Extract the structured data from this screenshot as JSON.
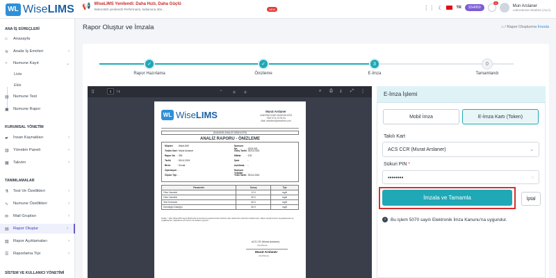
{
  "brand": {
    "badge": "WL",
    "name_light": "Wise",
    "name_bold": "LIMS"
  },
  "announcement": {
    "title": "WiseLIMS Yenilendi: Daha Hızlı, Daha Güçlü",
    "subtitle": "WiseLIMS yenilendi! Performans, kullanıma dön…",
    "badge": "NEW"
  },
  "topbar": {
    "lang": "TR",
    "storage_badge": "SS4950",
    "notif_count": "0",
    "user_name": "Mun Arslaner",
    "user_role": "Laboratuvar Müdürü (ALA)"
  },
  "sidebar": {
    "section1": "ANA İŞ SÜREÇLERİ",
    "section2": "KURUMSAL YÖNETİM",
    "section3": "TANIMLAMALAR",
    "section4": "SİSTEM VE KULLANICI YÖNETİMİ",
    "items": [
      {
        "label": "Anasayfa"
      },
      {
        "label": "Analiz İş Emirleri"
      },
      {
        "label": "Numune Kayıt"
      },
      {
        "label": "Numune Test"
      },
      {
        "label": "Numune Rapor"
      },
      {
        "label": "İnsan Kaynakları"
      },
      {
        "label": "Yönetim Paneli"
      },
      {
        "label": "Takvim"
      },
      {
        "label": "Test Ve Özellikleri"
      },
      {
        "label": "Numune Özellikleri"
      },
      {
        "label": "Mail Grupları"
      },
      {
        "label": "Rapor Oluştur"
      },
      {
        "label": "Rapor Açıklamaları"
      },
      {
        "label": "Raporlama Tipi"
      }
    ],
    "sub": {
      "liste": "Liste",
      "ekle": "Ekle"
    }
  },
  "page": {
    "title": "Rapor Oluştur ve İmzala",
    "breadcrumb_parent": "Rapor Oluşturma",
    "breadcrumb_current": "İmzala"
  },
  "steps": [
    {
      "label": "Rapor Hazırlama",
      "mark": "✓"
    },
    {
      "label": "Önizleme",
      "mark": "✓"
    },
    {
      "label": "E-İmza",
      "mark": "3"
    },
    {
      "label": "Tamamlandı",
      "mark": "0"
    }
  ],
  "viewer": {
    "page": "1",
    "page_total": "/ 1"
  },
  "doc": {
    "company": "Murat Arslaner",
    "company_sub": "LABORATUVAR MÜDÜRLÜĞÜ",
    "company_tel": "+567 673 10 05 00",
    "company_mail": "Mail: wiselims@wiselims.com",
    "head_bar": "[NUMUNE ANALİZİ ARŞİVLERİ]",
    "title": "ANALİZ RAPORU - ÖNİZLEME",
    "left": [
      {
        "k": "Müşteri",
        "v": ": WiseLIMS"
      },
      {
        "k": "Teslim Kart",
        "v": ": Murat Arslaner"
      },
      {
        "k": "Rapor No",
        "v": ": 335"
      },
      {
        "k": "Tarihi",
        "v": ": 05.04.2024"
      },
      {
        "k": "Birim",
        "v": ": Sonda"
      },
      {
        "k": "Operasyon",
        "v": ": -"
      },
      {
        "k": "Ölçüm Tipi",
        "v": ": -"
      }
    ],
    "right": [
      {
        "k": "Numune No",
        "v": ": 2024-001"
      },
      {
        "k": "Geliş Tarihi",
        "v": ": 05.04.2024"
      },
      {
        "k": "Miktar",
        "v": ": 100"
      },
      {
        "k": "Şartı",
        "v": ": -"
      },
      {
        "k": "Açıklama",
        "v": ": -"
      },
      {
        "k": "Numune Yetkilisi",
        "v": ": -"
      },
      {
        "k": "Yetki Tarihi",
        "v": ": 05.04.2024"
      }
    ],
    "table_headers": [
      "Parametre",
      "Sonuç",
      "Tipi"
    ],
    "table_rows": [
      [
        "Ofon Hazdeki",
        "12.0",
        "mg/lt"
      ],
      [
        "Ofon Hazdeki",
        "50.0",
        "mg/lt"
      ],
      [
        "Test Kodunde",
        "60.0",
        "mg/lt"
      ],
      [
        "Demiloğlu Katılığın",
        "60.0",
        "mg/lt"
      ]
    ],
    "note": "Notlar: * İşbu WiseLIMS sayılı Elektronik İmza kanunu kapsamında üretilmiş olup elektronik ortamda imzalanmıştır. Rapor içeriği kısmen kopyalanamaz ve çoğaltılamaz; doğrulama için kurum ile iletişime geçiniz.",
    "sig1": "ACS CR (Murat Arslaner)",
    "sig1_sub": "(Sertifikası)",
    "sig2": "Murat Arslaner",
    "sig2_sub": "(Sertifikası)"
  },
  "esign": {
    "title": "E-İmza İşlemi",
    "tab_mobile": "Mobil İmza",
    "tab_token": "E-İmza Kartı (Token)",
    "card_label": "Takılı Kart",
    "card_value": "ACS CCR (Murat Arslaner)",
    "pin_label": "Sükuri PIN",
    "pin_required": "*",
    "pin_value": "••••••••",
    "sign_button": "İmzala ve Tamamla",
    "cancel_button": "İptal",
    "info_text": "Bu işlem 5070 sayılı Elektronik İmza Kanunu'na uygundur."
  }
}
